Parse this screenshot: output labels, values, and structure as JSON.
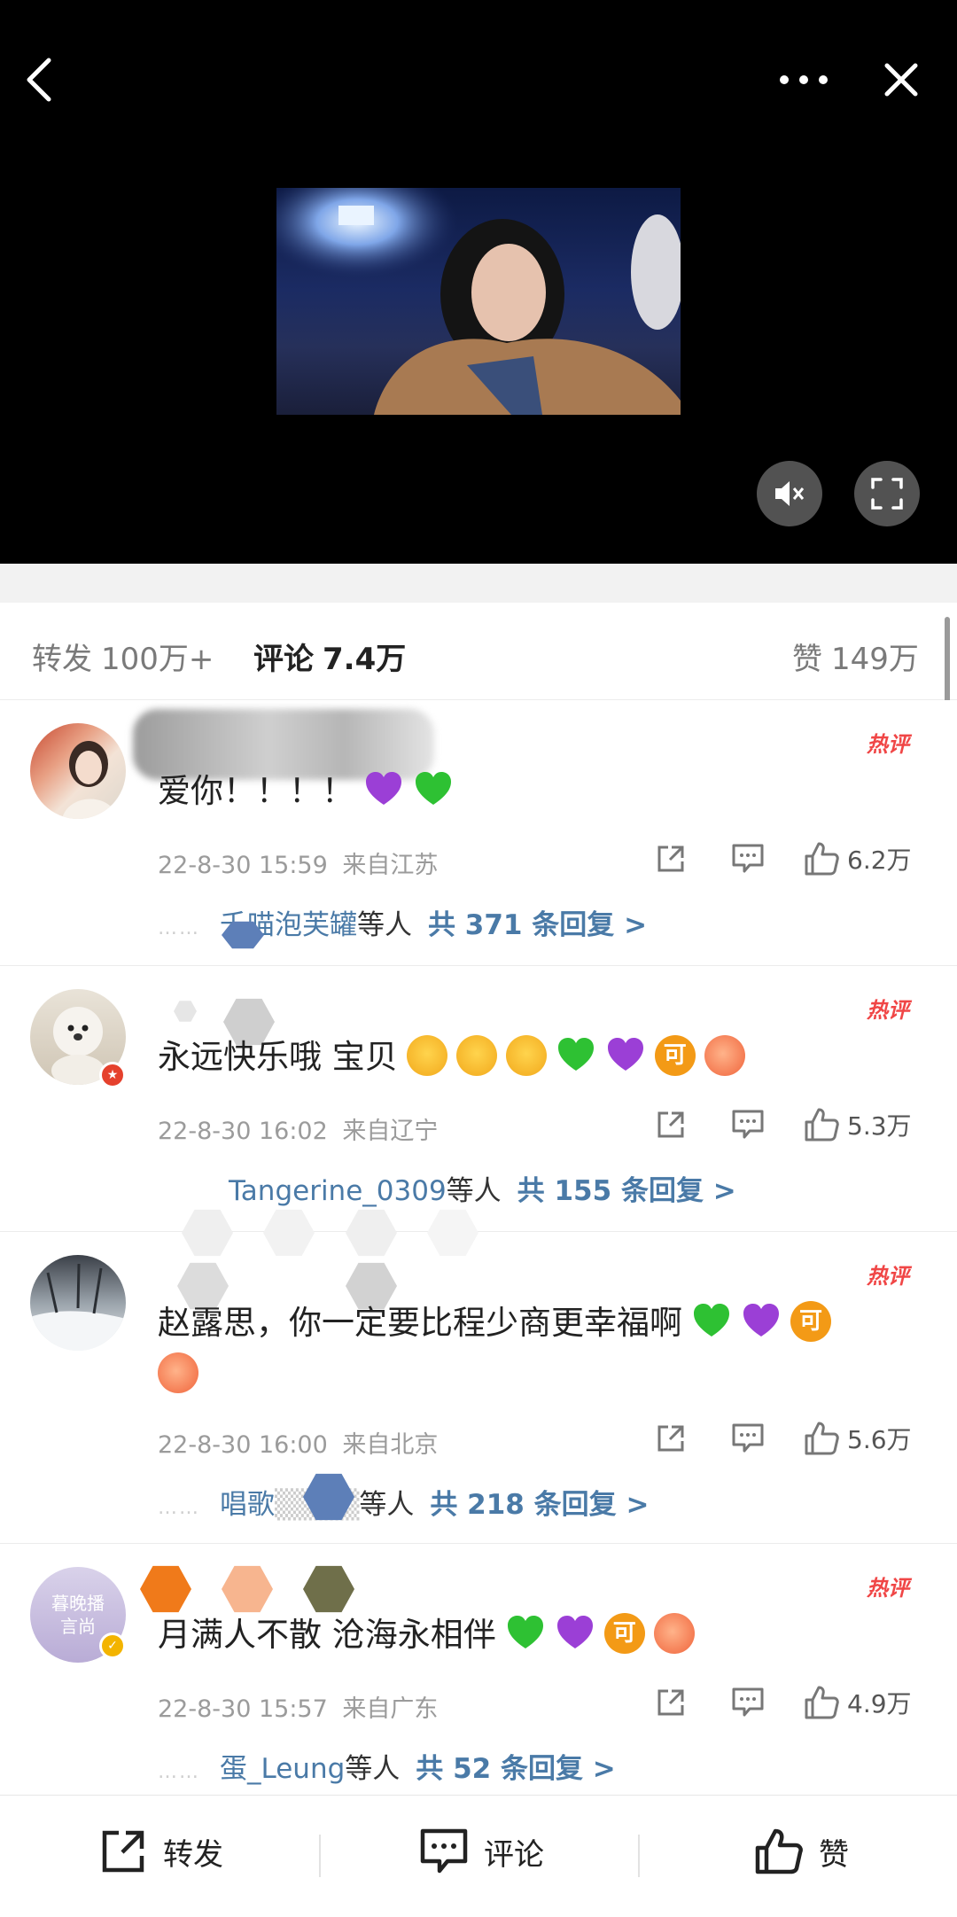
{
  "video": {
    "back_icon": "chevron-left-icon",
    "more_icon": "more-dots-icon",
    "close_icon": "close-icon",
    "mute_icon": "mute-icon",
    "fullscreen_icon": "fullscreen-icon"
  },
  "stats": {
    "repost_label": "转发",
    "repost_count": "100万+",
    "comment_label": "评论",
    "comment_count": "7.4万",
    "like_label": "赞",
    "like_count": "149万"
  },
  "comments": [
    {
      "hot_tag": "热评",
      "text": "爱你！！！！",
      "time": "22-8-30 15:59",
      "location": "来自江苏",
      "likes": "6.2万",
      "reply_dots": "……",
      "reply_name": "千喵泡芙罐",
      "reply_mid": "等人",
      "reply_total": "共 371 条回复 >"
    },
    {
      "hot_tag": "热评",
      "text": "永远快乐哦 宝贝",
      "time": "22-8-30 16:02",
      "location": "来自辽宁",
      "likes": "5.3万",
      "reply_name": "Tangerine_0309",
      "reply_mid": "等人",
      "reply_total": "共 155 条回复 >"
    },
    {
      "hot_tag": "热评",
      "text": "赵露思，你一定要比程少商更幸福啊",
      "time": "22-8-30 16:00",
      "location": "来自北京",
      "likes": "5.6万",
      "reply_dots": "……",
      "reply_name": "唱歌",
      "reply_mid": "等人",
      "reply_total": "共 218 条回复 >"
    },
    {
      "hot_tag": "热评",
      "text": "月满人不散 沧海永相伴",
      "time": "22-8-30 15:57",
      "location": "来自广东",
      "likes": "4.9万",
      "reply_dots": "……",
      "reply_name": "蛋_Leung",
      "reply_mid": "等人",
      "reply_total": "共 52 条回复 >",
      "avatar_text": "暮晚播 言尚"
    }
  ],
  "emoji": {
    "ke_label": "可"
  },
  "bottom": {
    "repost_label": "转发",
    "comment_label": "评论",
    "like_label": "赞"
  },
  "colors": {
    "hot_tag": "#f04646",
    "link": "#4a7aa7",
    "ke_emoji": "#f39a16",
    "green_heart": "#2ec133",
    "purple_heart": "#9b3fd6"
  }
}
